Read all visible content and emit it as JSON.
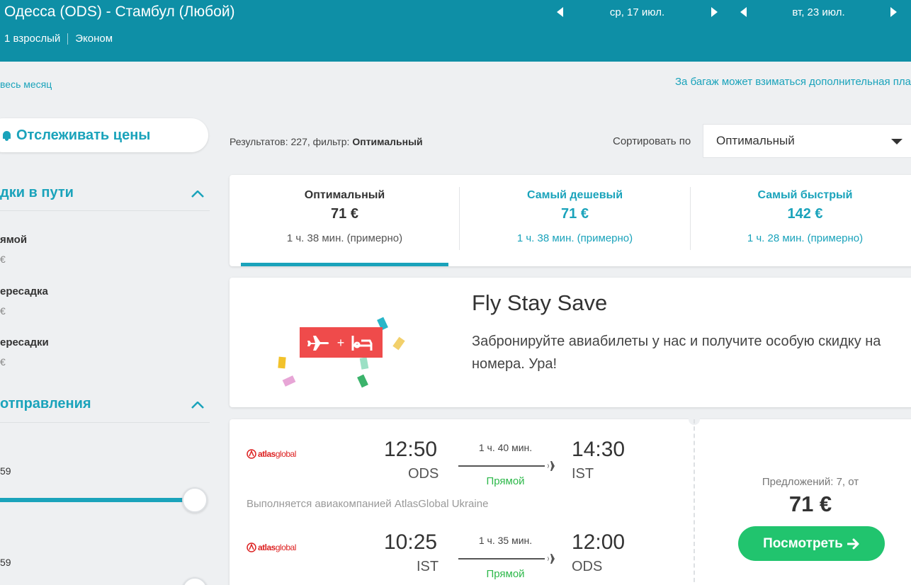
{
  "header": {
    "route": "Одесса (ODS) - Стамбул (Любой)",
    "passengers": "1 взрослый",
    "cabin": "Эконом",
    "depart_date": "ср, 17 июл.",
    "return_date": "вт, 23 июл."
  },
  "links": {
    "whole_month": "весь месяц",
    "baggage_note": "За багаж может взиматься дополнительная пла"
  },
  "sidebar": {
    "track_prices": "Отслеживать цены",
    "stops_title": "дки в пути",
    "stops": [
      {
        "label": "ямой",
        "price": "€"
      },
      {
        "label": "ересадка",
        "price": "€"
      },
      {
        "label": "ересадки",
        "price": "€"
      }
    ],
    "departure_title": "отправления",
    "time_values": [
      "59",
      "59"
    ]
  },
  "results": {
    "prefix": "Результатов: 227, фильтр: ",
    "filter": "Оптимальный",
    "sort_label": "Сортировать по",
    "sort_value": "Оптимальный"
  },
  "tabs": [
    {
      "title": "Оптимальный",
      "price": "71 €",
      "duration": "1 ч. 38 мин. (примерно)"
    },
    {
      "title": "Самый дешевый",
      "price": "71 €",
      "duration": "1 ч. 38 мин. (примерно)"
    },
    {
      "title": "Самый быстрый",
      "price": "142 €",
      "duration": "1 ч. 28 мин. (примерно)"
    }
  ],
  "promo": {
    "title": "Fly Stay Save",
    "text": "Забронируйте авиабилеты у нас и получите особую скидку на номера. Ура!"
  },
  "flight": {
    "airline_logo_text": "atlas",
    "airline_logo_text2": "global",
    "operated_by": "Выполняется авиакомпанией AtlasGlobal Ukraine",
    "outbound": {
      "dep_time": "12:50",
      "dep_code": "ODS",
      "duration": "1 ч. 40 мин.",
      "stops": "Прямой",
      "arr_time": "14:30",
      "arr_code": "IST"
    },
    "inbound": {
      "dep_time": "10:25",
      "dep_code": "IST",
      "duration": "1 ч. 35 мин.",
      "stops": "Прямой",
      "arr_time": "12:00",
      "arr_code": "ODS"
    },
    "offers": "Предложений: 7, от",
    "price": "71 €",
    "view_button": "Посмотреть"
  },
  "colors": {
    "header_bg": "#0e8fa6",
    "accent": "#1aa3bb",
    "button_green": "#21c46e",
    "promo_red": "#ef4b4b"
  }
}
